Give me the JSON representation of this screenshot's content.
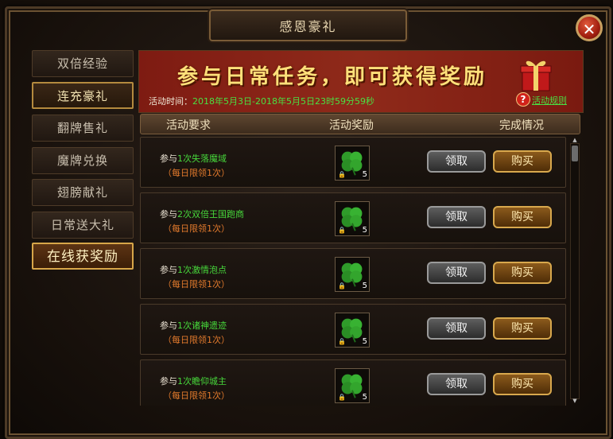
{
  "window": {
    "title": "感恩豪礼",
    "close_label": "✕"
  },
  "sidebar": {
    "items": [
      {
        "label": "双倍经验"
      },
      {
        "label": "连充豪礼"
      },
      {
        "label": "翻牌售礼"
      },
      {
        "label": "魔牌兑换"
      },
      {
        "label": "翅膀献礼"
      },
      {
        "label": "日常送大礼"
      },
      {
        "label": "在线获奖励"
      }
    ]
  },
  "banner": {
    "headline": "参与日常任务，即可获得奖励",
    "time_label": "活动时间：",
    "time_value": "2018年5月3日-2018年5月5日23时59分59秒",
    "help_icon": "?",
    "rules_link": "活动规则"
  },
  "list_header": {
    "requirement": "活动要求",
    "reward": "活动奖励",
    "status": "完成情况"
  },
  "rows": [
    {
      "prefix": "参与",
      "target": "1次失落魔域",
      "limit": "（每日限领1次）",
      "reward_count": "5",
      "claim": "领取",
      "buy": "购买"
    },
    {
      "prefix": "参与",
      "target": "2次双倍王国跑商",
      "limit": "（每日限领1次）",
      "reward_count": "5",
      "claim": "领取",
      "buy": "购买"
    },
    {
      "prefix": "参与",
      "target": "1次激情泡点",
      "limit": "（每日限领1次）",
      "reward_count": "5",
      "claim": "领取",
      "buy": "购买"
    },
    {
      "prefix": "参与",
      "target": "1次诸神遗迹",
      "limit": "（每日限领1次）",
      "reward_count": "5",
      "claim": "领取",
      "buy": "购买"
    },
    {
      "prefix": "参与",
      "target": "1次瞻仰城主",
      "limit": "（每日限领1次）",
      "reward_count": "5",
      "claim": "领取",
      "buy": "购买"
    }
  ],
  "colors": {
    "highlight_green": "#47d83b",
    "limit_orange": "#e27a2c",
    "banner_text": "#ffe07a"
  },
  "icons": {
    "reward_item": "four-leaf-clover-icon",
    "gift": "gift-box-icon"
  }
}
